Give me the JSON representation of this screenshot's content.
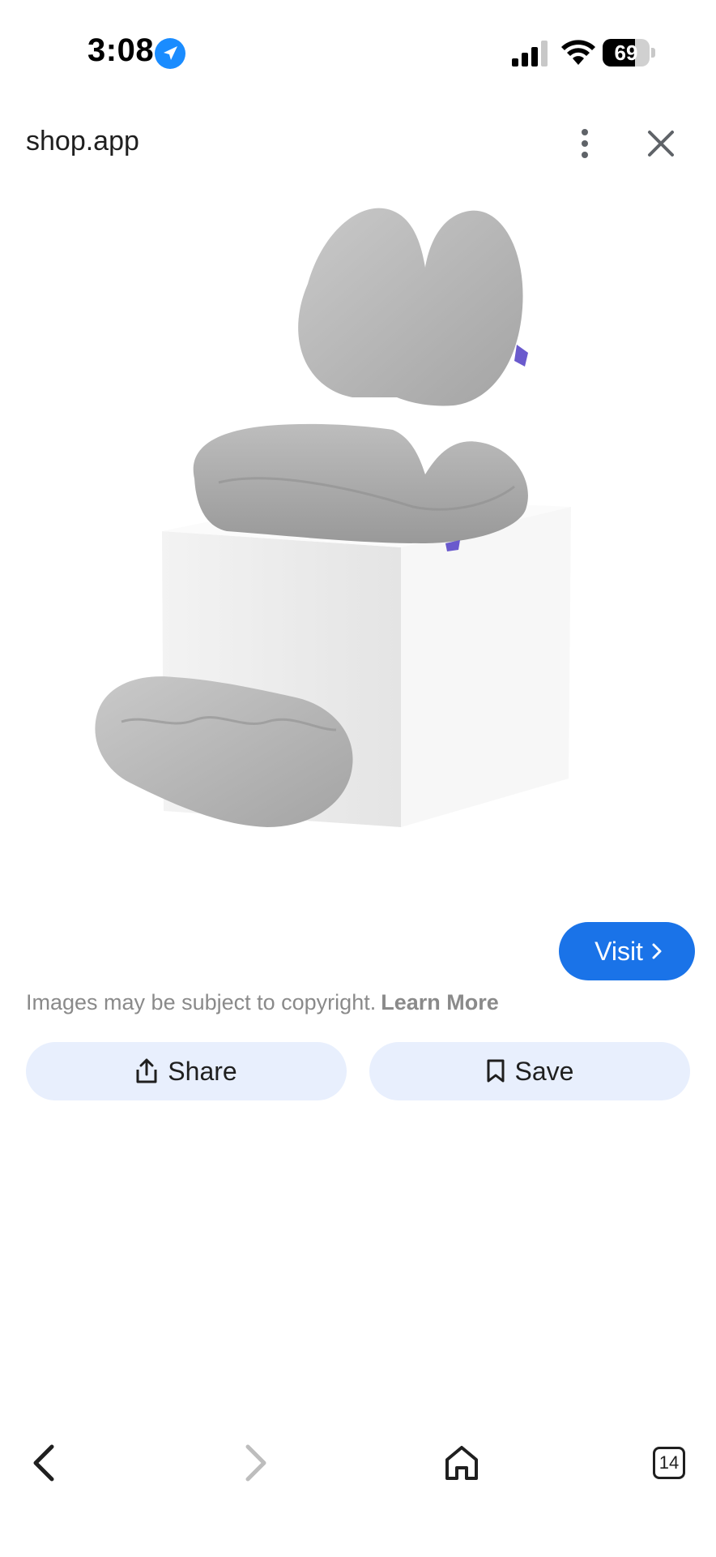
{
  "status_bar": {
    "time": "3:08",
    "battery_level": "69",
    "icons": [
      "location-arrow-icon",
      "cellular-signal-icon",
      "wifi-icon",
      "battery-icon"
    ]
  },
  "header": {
    "site": "shop.app",
    "icons": [
      "more-vert-icon",
      "close-icon"
    ]
  },
  "product_image": {
    "subject": "grey memory foam seat cushion, lumbar back support and footrest"
  },
  "actions": {
    "visit_label": "Visit",
    "copyright_text": "Images may be subject to copyright.",
    "learn_more_label": "Learn More",
    "share_label": "Share",
    "save_label": "Save"
  },
  "bottom_nav": {
    "tab_count": "14",
    "icons": [
      "back-arrow-icon",
      "forward-arrow-icon",
      "home-icon",
      "tabs-icon"
    ]
  },
  "colors": {
    "accent": "#1a73e8",
    "pill_bg": "#e8effd",
    "muted_text": "#8a8a8a"
  }
}
